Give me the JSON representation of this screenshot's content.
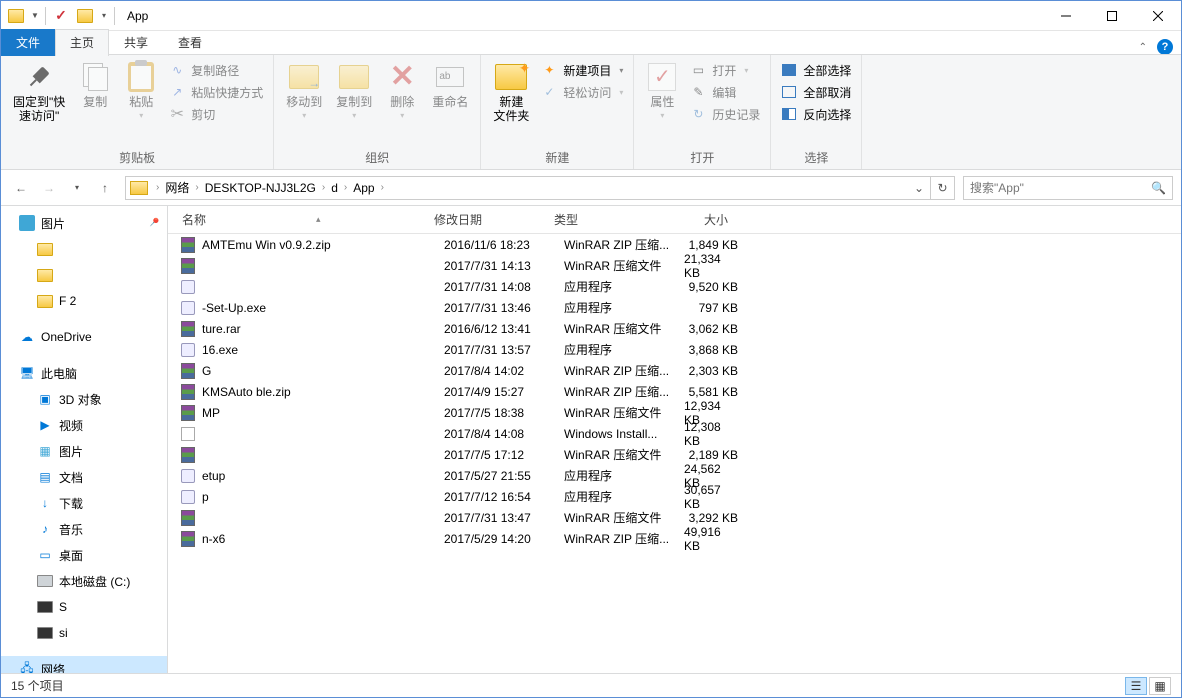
{
  "title": "App",
  "tabs": {
    "file": "文件",
    "home": "主页",
    "share": "共享",
    "view": "查看"
  },
  "ribbon": {
    "pin": "固定到\"快\n速访问\"",
    "copy": "复制",
    "paste": "粘贴",
    "copypath": "复制路径",
    "pasteshortcut": "粘贴快捷方式",
    "cut": "剪切",
    "group_clipboard": "剪贴板",
    "moveto": "移动到",
    "copyto": "复制到",
    "delete": "删除",
    "rename": "重命名",
    "group_org": "组织",
    "newfolder": "新建\n文件夹",
    "newitem": "新建项目",
    "easyaccess": "轻松访问",
    "group_new": "新建",
    "properties": "属性",
    "open": "打开",
    "edit": "编辑",
    "history": "历史记录",
    "group_open": "打开",
    "selectall": "全部选择",
    "selectnone": "全部取消",
    "invert": "反向选择",
    "group_select": "选择"
  },
  "breadcrumbs": [
    "网络",
    "DESKTOP-NJJ3L2G",
    "d",
    "App"
  ],
  "search_placeholder": "搜索\"App\"",
  "columns": {
    "name": "名称",
    "date": "修改日期",
    "type": "类型",
    "size": "大小"
  },
  "tree": {
    "pictures": "图片",
    "onedrive": "OneDrive",
    "thispc": "此电脑",
    "objects3d": "3D 对象",
    "videos": "视频",
    "pictures2": "图片",
    "documents": "文档",
    "downloads": "下载",
    "music": "音乐",
    "desktop": "桌面",
    "localc": "本地磁盘 (C:)",
    "network": "网络",
    "obs_s": "S",
    "obs_si": "si",
    "obs_f": "F   2"
  },
  "files": [
    {
      "name": "AMTEmu Win v0.9.2.zip",
      "date": "2016/11/6 18:23",
      "type": "WinRAR ZIP 压缩...",
      "size": "1,849 KB",
      "ico": "rar"
    },
    {
      "name": "",
      "date": "2017/7/31 14:13",
      "type": "WinRAR 压缩文件",
      "size": "21,334 KB",
      "ico": "rar"
    },
    {
      "name": "",
      "date": "2017/7/31 14:08",
      "type": "应用程序",
      "size": "9,520 KB",
      "ico": "exe"
    },
    {
      "name": "            -Set-Up.exe",
      "date": "2017/7/31 13:46",
      "type": "应用程序",
      "size": "797 KB",
      "ico": "exe"
    },
    {
      "name": "            ture.rar",
      "date": "2016/6/12 13:41",
      "type": "WinRAR 压缩文件",
      "size": "3,062 KB",
      "ico": "rar"
    },
    {
      "name": "              16.exe",
      "date": "2017/7/31 13:57",
      "type": "应用程序",
      "size": "3,868 KB",
      "ico": "exe"
    },
    {
      "name": "G",
      "date": "2017/8/4 14:02",
      "type": "WinRAR ZIP 压缩...",
      "size": "2,303 KB",
      "ico": "rar"
    },
    {
      "name": "KMSAuto              ble.zip",
      "date": "2017/4/9 15:27",
      "type": "WinRAR ZIP 压缩...",
      "size": "5,581 KB",
      "ico": "rar"
    },
    {
      "name": "MP",
      "date": "2017/7/5 18:38",
      "type": "WinRAR 压缩文件",
      "size": "12,934 KB",
      "ico": "rar"
    },
    {
      "name": "",
      "date": "2017/8/4 14:08",
      "type": "Windows Install...",
      "size": "12,308 KB",
      "ico": "msi"
    },
    {
      "name": "",
      "date": "2017/7/5 17:12",
      "type": "WinRAR 压缩文件",
      "size": "2,189 KB",
      "ico": "rar"
    },
    {
      "name": "           etup",
      "date": "2017/5/27 21:55",
      "type": "应用程序",
      "size": "24,562 KB",
      "ico": "exe"
    },
    {
      "name": "p",
      "date": "2017/7/12 16:54",
      "type": "应用程序",
      "size": "30,657 KB",
      "ico": "exe"
    },
    {
      "name": "",
      "date": "2017/7/31 13:47",
      "type": "WinRAR 压缩文件",
      "size": "3,292 KB",
      "ico": "rar"
    },
    {
      "name": "          n-x6",
      "date": "2017/5/29 14:20",
      "type": "WinRAR ZIP 压缩...",
      "size": "49,916 KB",
      "ico": "rar"
    }
  ],
  "status": "15 个项目"
}
